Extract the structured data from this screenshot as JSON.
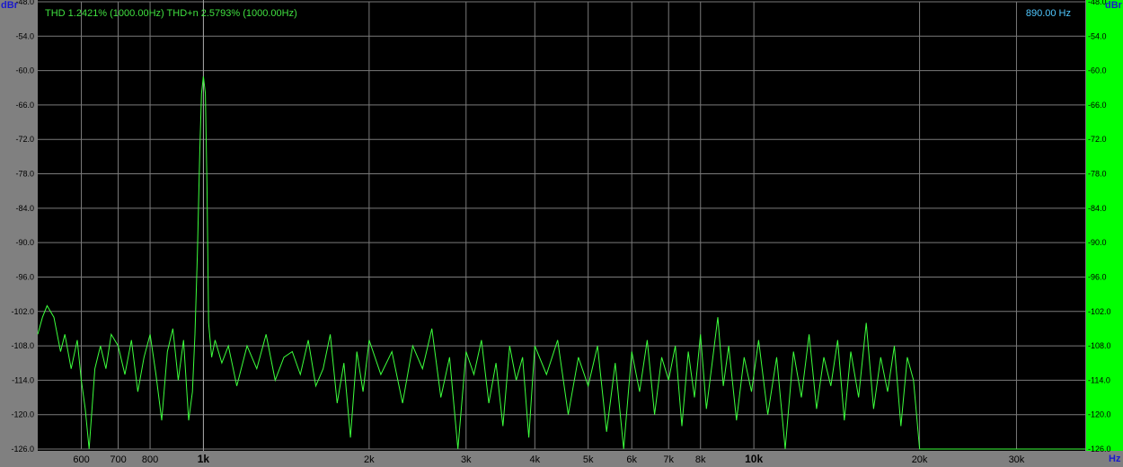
{
  "colors": {
    "background": "#808080",
    "plot": "#000000",
    "grid": "#7a7a7a",
    "trace": "#3cff3c",
    "thd_text": "#40e040",
    "cursor_text": "#50c8ff",
    "right_strip": "#00ff00",
    "unit_text": "#1a1acc"
  },
  "readouts": {
    "thd": "THD 1.2421% (1000.00Hz) THD+n 2.5793% (1000.00Hz)",
    "cursor_freq": "890.00 Hz"
  },
  "chart_data": {
    "type": "line",
    "xscale": "log",
    "xlim": [
      500,
      40000
    ],
    "ylim": [
      -126,
      -48
    ],
    "ylabel": "dBr",
    "xlabel": "Hz",
    "grid": true,
    "yticks": [
      "-48.0",
      "-54.0",
      "-60.0",
      "-66.0",
      "-72.0",
      "-78.0",
      "-84.0",
      "-90.0",
      "-96.0",
      "-102.0",
      "-108.0",
      "-114.0",
      "-120.0",
      "-126.0"
    ],
    "xticks": [
      {
        "value": 600,
        "label": "600",
        "major": false
      },
      {
        "value": 700,
        "label": "700",
        "major": false
      },
      {
        "value": 800,
        "label": "800",
        "major": false
      },
      {
        "value": 1000,
        "label": "1k",
        "major": true
      },
      {
        "value": 2000,
        "label": "2k",
        "major": false
      },
      {
        "value": 3000,
        "label": "3k",
        "major": false
      },
      {
        "value": 4000,
        "label": "4k",
        "major": false
      },
      {
        "value": 5000,
        "label": "5k",
        "major": false
      },
      {
        "value": 6000,
        "label": "6k",
        "major": false
      },
      {
        "value": 7000,
        "label": "7k",
        "major": false
      },
      {
        "value": 8000,
        "label": "8k",
        "major": false
      },
      {
        "value": 10000,
        "label": "10k",
        "major": true
      },
      {
        "value": 20000,
        "label": "20k",
        "major": false
      },
      {
        "value": 30000,
        "label": "30k",
        "major": false
      }
    ],
    "cursor_x": 1000,
    "series": [
      {
        "points": [
          [
            500,
            -106
          ],
          [
            510,
            -103
          ],
          [
            520,
            -101
          ],
          [
            535,
            -103
          ],
          [
            550,
            -109
          ],
          [
            560,
            -106
          ],
          [
            575,
            -112
          ],
          [
            590,
            -107
          ],
          [
            600,
            -114
          ],
          [
            610,
            -119
          ],
          [
            620,
            -126
          ],
          [
            635,
            -112
          ],
          [
            650,
            -108
          ],
          [
            665,
            -112
          ],
          [
            680,
            -106
          ],
          [
            700,
            -108
          ],
          [
            720,
            -113
          ],
          [
            740,
            -107
          ],
          [
            760,
            -116
          ],
          [
            780,
            -110
          ],
          [
            800,
            -106
          ],
          [
            820,
            -113
          ],
          [
            840,
            -121
          ],
          [
            860,
            -109
          ],
          [
            880,
            -105
          ],
          [
            900,
            -114
          ],
          [
            920,
            -107
          ],
          [
            940,
            -121
          ],
          [
            955,
            -116
          ],
          [
            965,
            -106
          ],
          [
            975,
            -92
          ],
          [
            985,
            -74
          ],
          [
            992,
            -64
          ],
          [
            1000,
            -61
          ],
          [
            1008,
            -64
          ],
          [
            1015,
            -80
          ],
          [
            1022,
            -104
          ],
          [
            1035,
            -110
          ],
          [
            1050,
            -107
          ],
          [
            1080,
            -111
          ],
          [
            1110,
            -108
          ],
          [
            1150,
            -115
          ],
          [
            1200,
            -108
          ],
          [
            1250,
            -112
          ],
          [
            1300,
            -106
          ],
          [
            1350,
            -114
          ],
          [
            1400,
            -110
          ],
          [
            1450,
            -109
          ],
          [
            1500,
            -113
          ],
          [
            1550,
            -107
          ],
          [
            1600,
            -115
          ],
          [
            1650,
            -112
          ],
          [
            1700,
            -106
          ],
          [
            1750,
            -118
          ],
          [
            1800,
            -111
          ],
          [
            1850,
            -124
          ],
          [
            1900,
            -109
          ],
          [
            1950,
            -116
          ],
          [
            2000,
            -107
          ],
          [
            2100,
            -113
          ],
          [
            2200,
            -109
          ],
          [
            2300,
            -118
          ],
          [
            2400,
            -108
          ],
          [
            2500,
            -112
          ],
          [
            2600,
            -105
          ],
          [
            2700,
            -117
          ],
          [
            2800,
            -110
          ],
          [
            2900,
            -126
          ],
          [
            3000,
            -109
          ],
          [
            3100,
            -113
          ],
          [
            3200,
            -107
          ],
          [
            3300,
            -118
          ],
          [
            3400,
            -111
          ],
          [
            3500,
            -122
          ],
          [
            3600,
            -108
          ],
          [
            3700,
            -114
          ],
          [
            3800,
            -110
          ],
          [
            3900,
            -124
          ],
          [
            4000,
            -108
          ],
          [
            4200,
            -113
          ],
          [
            4400,
            -107
          ],
          [
            4600,
            -120
          ],
          [
            4800,
            -110
          ],
          [
            5000,
            -115
          ],
          [
            5200,
            -108
          ],
          [
            5400,
            -123
          ],
          [
            5600,
            -111
          ],
          [
            5800,
            -126
          ],
          [
            6000,
            -109
          ],
          [
            6200,
            -116
          ],
          [
            6400,
            -107
          ],
          [
            6600,
            -120
          ],
          [
            6800,
            -110
          ],
          [
            7000,
            -114
          ],
          [
            7200,
            -108
          ],
          [
            7400,
            -122
          ],
          [
            7600,
            -109
          ],
          [
            7800,
            -117
          ],
          [
            8000,
            -106
          ],
          [
            8200,
            -119
          ],
          [
            8400,
            -111
          ],
          [
            8600,
            -103
          ],
          [
            8800,
            -115
          ],
          [
            9000,
            -108
          ],
          [
            9300,
            -121
          ],
          [
            9600,
            -110
          ],
          [
            9900,
            -116
          ],
          [
            10200,
            -107
          ],
          [
            10600,
            -120
          ],
          [
            11000,
            -110
          ],
          [
            11400,
            -126
          ],
          [
            11800,
            -109
          ],
          [
            12200,
            -117
          ],
          [
            12600,
            -106
          ],
          [
            13000,
            -119
          ],
          [
            13400,
            -110
          ],
          [
            13800,
            -115
          ],
          [
            14200,
            -107
          ],
          [
            14600,
            -121
          ],
          [
            15000,
            -109
          ],
          [
            15500,
            -117
          ],
          [
            16000,
            -104
          ],
          [
            16500,
            -119
          ],
          [
            17000,
            -110
          ],
          [
            17500,
            -116
          ],
          [
            18000,
            -108
          ],
          [
            18500,
            -122
          ],
          [
            19000,
            -110
          ],
          [
            19500,
            -114
          ],
          [
            20000,
            -126
          ],
          [
            21000,
            -126
          ],
          [
            30000,
            -126
          ],
          [
            40000,
            -126
          ]
        ]
      }
    ]
  }
}
